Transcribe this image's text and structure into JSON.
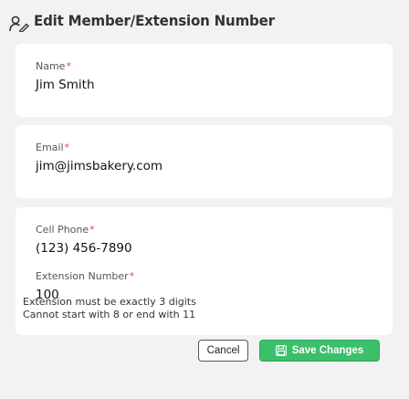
{
  "header": {
    "title": "Edit Member/Extension Number",
    "icon": "person-edit-icon"
  },
  "fields": {
    "name": {
      "label": "Name",
      "required_mark": "*",
      "value": "Jim Smith"
    },
    "email": {
      "label": "Email",
      "required_mark": "*",
      "value": "jim@jimsbakery.com"
    },
    "cell_phone": {
      "label": "Cell Phone",
      "required_mark": "*",
      "value": "(123) 456-7890"
    },
    "extension": {
      "label": "Extension Number",
      "required_mark": "*",
      "value": "100"
    }
  },
  "hints": {
    "line1": "Extension must be exactly 3 digits",
    "line2": "Cannot start with 8 or end with 11"
  },
  "actions": {
    "cancel_label": "Cancel",
    "save_label": "Save Changes",
    "save_icon": "floppy-disk-icon"
  },
  "colors": {
    "background": "#f2f2f2",
    "card": "#ffffff",
    "required": "#e04a4a",
    "save_button": "#3bbf6a"
  }
}
